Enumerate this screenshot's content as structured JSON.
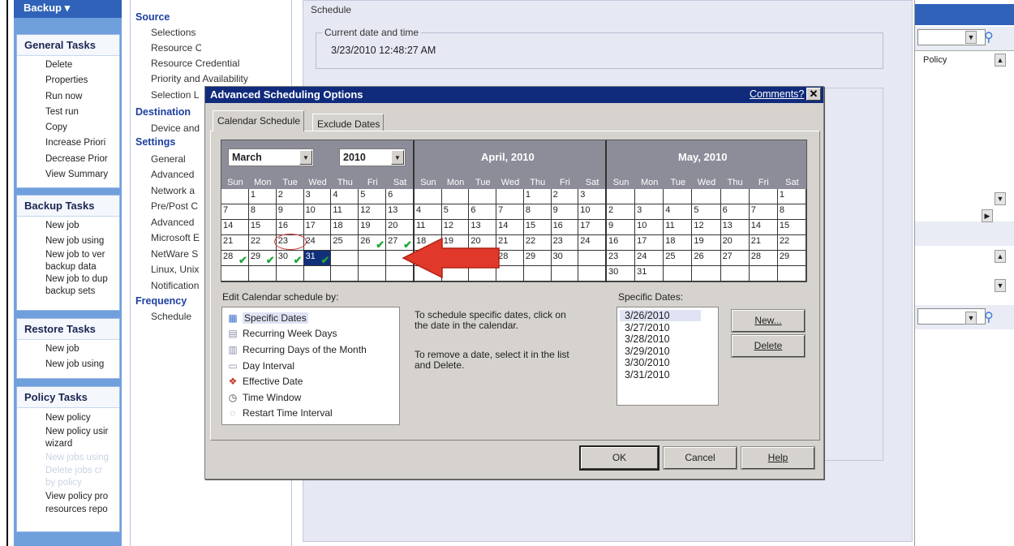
{
  "taskpane": {
    "top_label": "Backup",
    "groups": [
      {
        "title": "General Tasks",
        "items": [
          "Delete",
          "Properties",
          "Run now",
          "Test run",
          "Copy",
          "Increase Priori",
          "Decrease Prior",
          "View Summary"
        ]
      },
      {
        "title": "Backup Tasks",
        "items": [
          "New job",
          "New job using",
          "New job to ver",
          "backup data",
          "New job to dup",
          "backup sets"
        ]
      },
      {
        "title": "Restore Tasks",
        "items": [
          "New job",
          "New job using"
        ]
      },
      {
        "title": "Policy Tasks",
        "items": [
          "New policy",
          "New policy usir",
          "wizard",
          "New jobs using",
          "Delete jobs cr",
          "by policy",
          "View policy pro",
          "resources repo"
        ]
      }
    ]
  },
  "nav": {
    "sections": [
      {
        "title": "Source",
        "items": [
          "Selections",
          "Resource Order",
          "Resource Credentials",
          "Priority and Availability",
          "Selection L"
        ]
      },
      {
        "title": "Destination",
        "items": [
          "Device and"
        ]
      },
      {
        "title": "Settings",
        "items": [
          "General",
          "Advanced",
          "Network a",
          "Pre/Post C",
          "Advanced",
          "Microsoft E",
          "NetWare S",
          "Linux, Unix",
          "Notification"
        ]
      },
      {
        "title": "Frequency",
        "items": [
          "Schedule"
        ]
      }
    ]
  },
  "schedule": {
    "header": "Schedule",
    "current_label": "Current date and time",
    "current_value": "3/23/2010 12:48:27 AM"
  },
  "right": {
    "column": "Policy"
  },
  "dialog": {
    "title": "Advanced Scheduling Options",
    "comments": "Comments?",
    "close": "✕",
    "tabs": [
      "Calendar Schedule",
      "Exclude Dates"
    ],
    "month_select": "March",
    "year_select": "2010",
    "months": [
      {
        "title": "",
        "rows": [
          [
            "",
            "1",
            "2",
            "3",
            "4",
            "5",
            "6"
          ],
          [
            "7",
            "8",
            "9",
            "10",
            "11",
            "12",
            "13"
          ],
          [
            "14",
            "15",
            "16",
            "17",
            "18",
            "19",
            "20"
          ],
          [
            "21",
            "22",
            "23",
            "24",
            "25",
            "26",
            "27"
          ],
          [
            "28",
            "29",
            "30",
            "31",
            "",
            "",
            ""
          ],
          [
            "",
            "",
            "",
            "",
            "",
            "",
            ""
          ]
        ]
      },
      {
        "title": "April, 2010",
        "rows": [
          [
            "",
            "",
            "",
            "",
            "1",
            "2",
            "3"
          ],
          [
            "4",
            "5",
            "6",
            "7",
            "8",
            "9",
            "10"
          ],
          [
            "11",
            "12",
            "13",
            "14",
            "15",
            "16",
            "17"
          ],
          [
            "18",
            "19",
            "20",
            "21",
            "22",
            "23",
            "24"
          ],
          [
            "25",
            "26",
            "27",
            "28",
            "29",
            "30",
            ""
          ],
          [
            "",
            "",
            "",
            "",
            "",
            "",
            ""
          ]
        ]
      },
      {
        "title": "May, 2010",
        "rows": [
          [
            "",
            "",
            "",
            "",
            "",
            "",
            "1"
          ],
          [
            "2",
            "3",
            "4",
            "5",
            "6",
            "7",
            "8"
          ],
          [
            "9",
            "10",
            "11",
            "12",
            "13",
            "14",
            "15"
          ],
          [
            "16",
            "17",
            "18",
            "19",
            "20",
            "21",
            "22"
          ],
          [
            "23",
            "24",
            "25",
            "26",
            "27",
            "28",
            "29"
          ],
          [
            "30",
            "31",
            "",
            "",
            "",
            "",
            ""
          ]
        ]
      }
    ],
    "days": [
      "Sun",
      "Mon",
      "Tue",
      "Wed",
      "Thu",
      "Fri",
      "Sat"
    ],
    "edit_label": "Edit Calendar schedule by:",
    "edit_options": [
      "Specific Dates",
      "Recurring Week Days",
      "Recurring Days of the Month",
      "Day Interval",
      "Effective Date",
      "Time Window",
      "Restart Time Interval"
    ],
    "hint1": "To schedule specific dates, click on the date in the calendar.",
    "hint2": "To remove a date, select it in the list and Delete.",
    "specific_label": "Specific Dates:",
    "specific_dates": [
      "3/26/2010",
      "3/27/2010",
      "3/28/2010",
      "3/29/2010",
      "3/30/2010",
      "3/31/2010"
    ],
    "new_btn": "New...",
    "delete_btn": "Delete",
    "ok_btn": "OK",
    "cancel_btn": "Cancel",
    "help_btn": "Help"
  }
}
